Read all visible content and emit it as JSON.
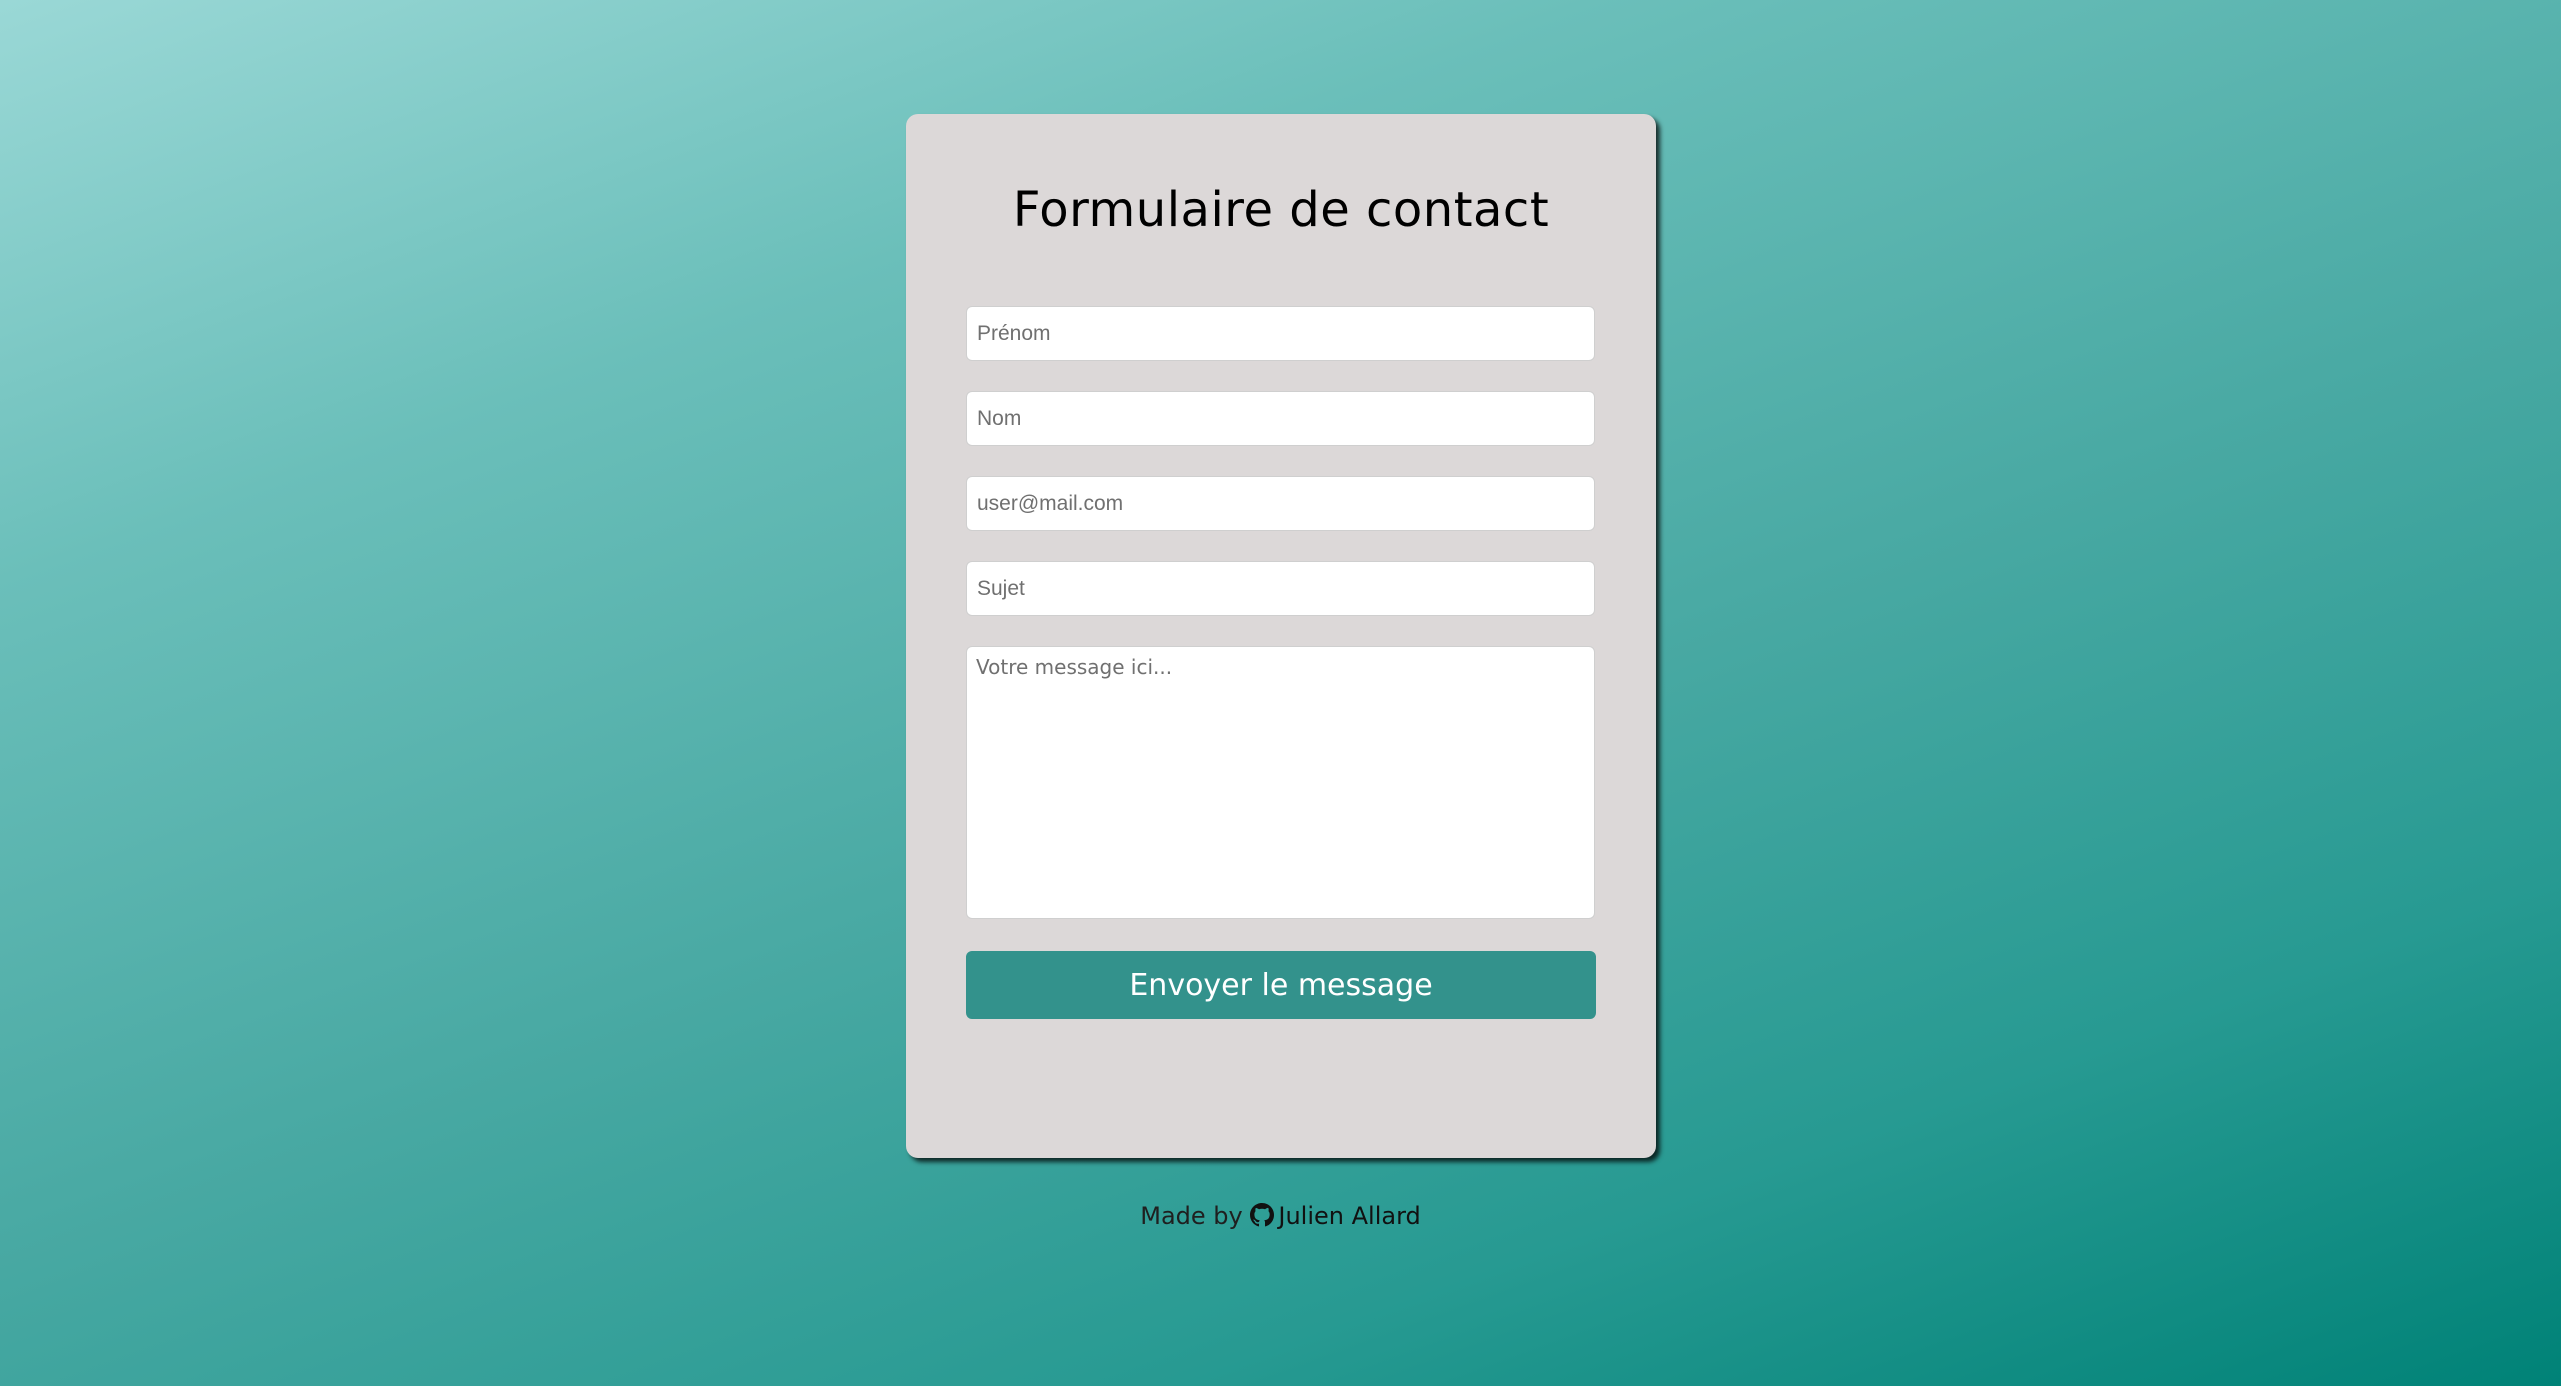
{
  "form": {
    "title": "Formulaire de contact",
    "fields": [
      {
        "name": "prenom",
        "placeholder": "Prénom",
        "value": ""
      },
      {
        "name": "nom",
        "placeholder": "Nom",
        "value": ""
      },
      {
        "name": "email",
        "placeholder": "user@mail.com",
        "value": ""
      },
      {
        "name": "sujet",
        "placeholder": "Sujet",
        "value": ""
      }
    ],
    "message": {
      "placeholder": "Votre message ici...",
      "value": ""
    },
    "submit_label": "Envoyer le message"
  },
  "footer": {
    "prefix": "Made by",
    "author": "Julien Allard",
    "icon": "github-icon"
  },
  "colors": {
    "card_background": "#dcd8d8",
    "button_background": "#33928c",
    "gradient_light": "#9ad8d6",
    "gradient_dark": "#008277"
  }
}
